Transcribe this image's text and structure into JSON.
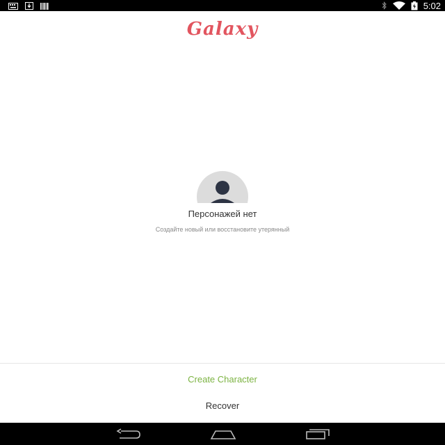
{
  "status_bar": {
    "time": "5:02",
    "left_icons": [
      "keyboard-notification-icon",
      "download-notification-icon",
      "barcode-notification-icon"
    ],
    "right_icons": [
      "bluetooth-icon",
      "wifi-icon",
      "battery-icon"
    ]
  },
  "app": {
    "title": "Galaxy",
    "title_color": "#e2555f"
  },
  "empty_state": {
    "icon": "person-icon",
    "title": "Персонажей нет",
    "subtitle": "Создайте новый или восстановите утерянный"
  },
  "actions": {
    "create_label": "Create Character",
    "create_color": "#7cb342",
    "recover_label": "Recover"
  },
  "nav_bar": {
    "buttons": [
      "back-icon",
      "home-icon",
      "recent-apps-icon"
    ]
  }
}
